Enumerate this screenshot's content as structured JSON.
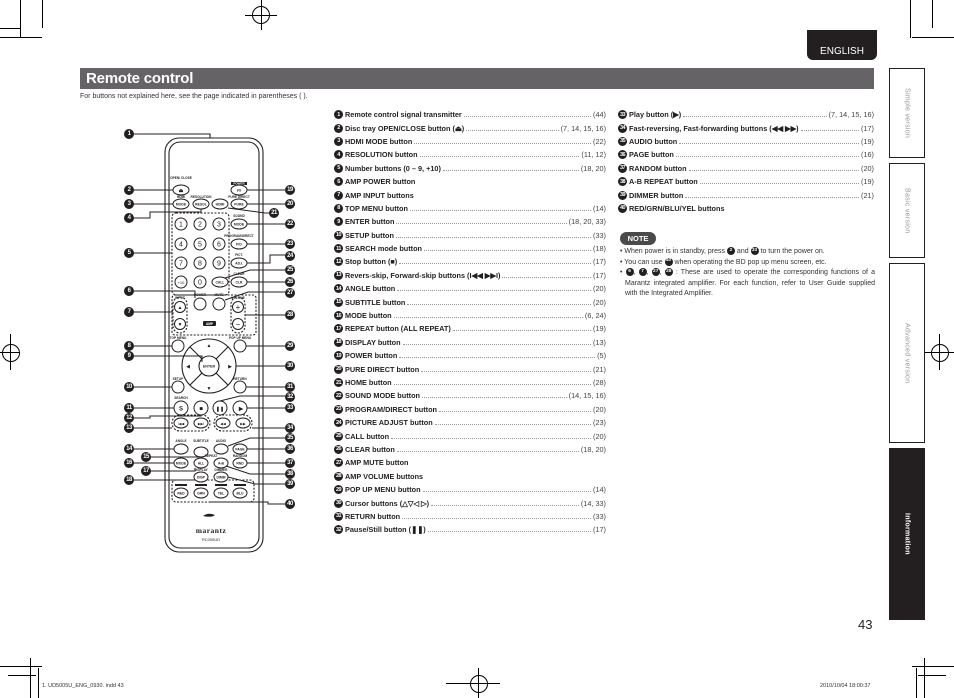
{
  "header": {
    "language_tab": "ENGLISH",
    "title": "Remote control",
    "intro": "For buttons not explained here, see the page indicated in parentheses ( )."
  },
  "side_tabs": [
    {
      "label": "Simple version",
      "active": false
    },
    {
      "label": "Basic version",
      "active": false
    },
    {
      "label": "Advanced version",
      "active": false
    },
    {
      "label": "Information",
      "active": true
    }
  ],
  "remote": {
    "brand": "marantz",
    "model": "RC005UD",
    "logo": "Blu-ray Disc",
    "labels": {
      "open_close": "OPEN/ CLOSE",
      "power": "POWER",
      "hdmi": "HDMI",
      "resolution": "RESOLUTION",
      "pure_direct": "PURE DIRECT",
      "sound": "SOUND",
      "program_direct": "PROGRAM/DIRECT",
      "pict": "PICT.",
      "clear": "CLEAR",
      "amp_power": "POWER",
      "mute": "MUTE",
      "input": "INPUT",
      "volume": "VOLUME",
      "amp": "AMP",
      "top_menu": "TOP MENU",
      "popup_menu": "POP UP MENU",
      "setup": "SETUP",
      "return": "RETURN",
      "search": "SEARCH",
      "angle": "ANGLE",
      "subtitle": "SUBTITLE",
      "audio": "AUDIO",
      "repeat": "REPEAT",
      "random": "RANDOM",
      "display": "DISPLAY",
      "dimmer": "DIMMER"
    },
    "buttons": {
      "eject": "⏏",
      "power": "I/O",
      "mode_hdmi": "MODE",
      "resol": "RESOL",
      "hdmi": "HDMI",
      "pure": "PURE",
      "sound_mode": "MODE",
      "numbers": [
        "1",
        "2",
        "3",
        "4",
        "5",
        "6",
        "7",
        "8",
        "9",
        "+10",
        "0"
      ],
      "pd": "P/D",
      "adj": "ADJ.",
      "call": "CALL",
      "clr": "CLR",
      "vol_up": "+",
      "vol_down": "−",
      "input_up": "▲",
      "input_down": "▼",
      "enter": "ENTER",
      "search": "S",
      "stop": "■",
      "pause": "❚❚",
      "play": "▶",
      "page": "PAGE",
      "mode": "MODE",
      "all": "ALL",
      "ab": "A-B",
      "rnd": "RND",
      "disp": "DISP",
      "dimm": "DIMM",
      "red": "RED",
      "grn": "GRN",
      "yel": "YEL",
      "blu": "BLU"
    }
  },
  "items_left": [
    {
      "n": "1",
      "label": "Remote control signal transmitter",
      "ref": "(44)"
    },
    {
      "n": "2",
      "label": "Disc tray OPEN/CLOSE button (⏏)",
      "ref": "(7, 14, 15, 16)"
    },
    {
      "n": "3",
      "label": "HDMI MODE button",
      "ref": "(22)"
    },
    {
      "n": "4",
      "label": "RESOLUTION button",
      "ref": "(11, 12)"
    },
    {
      "n": "5",
      "label": "Number buttons (0 – 9, +10)",
      "ref": "(18, 20)"
    },
    {
      "n": "6",
      "label": "AMP POWER button",
      "ref": ""
    },
    {
      "n": "7",
      "label": "AMP INPUT buttons",
      "ref": ""
    },
    {
      "n": "8",
      "label": "TOP MENU button",
      "ref": "(14)"
    },
    {
      "n": "9",
      "label": "ENTER button",
      "ref": "(18, 20, 33)"
    },
    {
      "n": "10",
      "label": "SETUP button",
      "ref": "(33)"
    },
    {
      "n": "11",
      "label": "SEARCH mode button",
      "ref": "(18)"
    },
    {
      "n": "12",
      "label": "Stop button (■)",
      "ref": "(17)"
    },
    {
      "n": "13",
      "label": "Revers-skip, Forward-skip buttons (I◀◀ ▶▶I)",
      "ref": "(17)"
    },
    {
      "n": "14",
      "label": "ANGLE button",
      "ref": "(20)"
    },
    {
      "n": "15",
      "label": "SUBTITLE button",
      "ref": "(20)"
    },
    {
      "n": "16",
      "label": "MODE button",
      "ref": "(6, 24)"
    },
    {
      "n": "17",
      "label": "REPEAT button (ALL REPEAT)",
      "ref": "(19)"
    },
    {
      "n": "18",
      "label": "DISPLAY button",
      "ref": "(13)"
    },
    {
      "n": "19",
      "label": "POWER button",
      "ref": "(5)"
    },
    {
      "n": "20",
      "label": "PURE DIRECT button",
      "ref": "(21)"
    },
    {
      "n": "21",
      "label": "HOME button",
      "ref": "(28)"
    },
    {
      "n": "22",
      "label": "SOUND MODE button",
      "ref": "(14, 15, 16)"
    },
    {
      "n": "23",
      "label": "PROGRAM/DIRECT button",
      "ref": "(20)"
    },
    {
      "n": "24",
      "label": "PICTURE ADJUST button",
      "ref": "(23)"
    },
    {
      "n": "25",
      "label": "CALL button",
      "ref": "(20)"
    },
    {
      "n": "26",
      "label": "CLEAR button",
      "ref": "(18, 20)"
    },
    {
      "n": "27",
      "label": "AMP MUTE button",
      "ref": ""
    },
    {
      "n": "28",
      "label": "AMP VOLUME buttons",
      "ref": ""
    },
    {
      "n": "29",
      "label": "POP UP MENU button",
      "ref": "(14)"
    },
    {
      "n": "30",
      "label": "Cursor buttons (△▽◁ ▷)",
      "ref": "(14, 33)"
    },
    {
      "n": "31",
      "label": "RETURN button",
      "ref": "(33)"
    },
    {
      "n": "32",
      "label": "Pause/Still button (❚❚)",
      "ref": "(17)"
    }
  ],
  "items_right": [
    {
      "n": "33",
      "label": "Play button (▶)",
      "ref": "(7, 14, 15, 16)"
    },
    {
      "n": "34",
      "label": "Fast-reversing, Fast-forwarding buttons (◀◀ ▶▶)",
      "ref": "(17)"
    },
    {
      "n": "35",
      "label": "AUDIO button",
      "ref": "(19)"
    },
    {
      "n": "36",
      "label": "PAGE button",
      "ref": "(16)"
    },
    {
      "n": "37",
      "label": "RANDOM button",
      "ref": "(20)"
    },
    {
      "n": "38",
      "label": "A-B REPEAT button",
      "ref": "(19)"
    },
    {
      "n": "39",
      "label": "DIMMER button",
      "ref": "(21)"
    },
    {
      "n": "40",
      "label": "RED/GRN/BLU/YEL buttons",
      "ref": ""
    }
  ],
  "note": {
    "title": "NOTE",
    "lines": [
      {
        "pre": "When power is in standby, press ",
        "refs": [
          "2",
          "33"
        ],
        "mid": " and ",
        "post": " to turn the power on."
      },
      {
        "pre": "You can use ",
        "refs": [
          "40"
        ],
        "post": "  when operating the BD pop up menu screen, etc."
      },
      {
        "pre": "",
        "refs": [
          "6",
          "7",
          "27",
          "28"
        ],
        "post": " : These are used to operate the corresponding functions of a Marantz integrated amplifier. For each function, refer to User Guide supplied with the Integrated Amplifier."
      }
    ]
  },
  "footer": {
    "page_number": "43",
    "file": "1. UD5005U_ENG_0930. indd    43",
    "timestamp": "2010/10/04    18:00:37"
  }
}
